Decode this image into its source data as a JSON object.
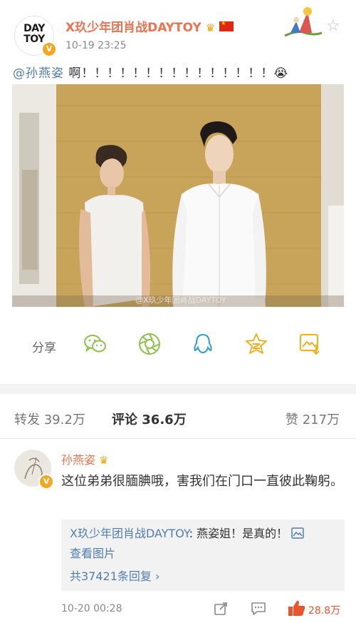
{
  "header": {
    "username": "X玖少年团肖战DAYTOY",
    "avatar_logo_line1": "DAY",
    "avatar_logo_line2": "TOY",
    "timestamp": "10-19 23:25"
  },
  "post": {
    "mention": "@孙燕姿",
    "text": " 啊！！！！！！！！！！！！！！！",
    "emoji": "😭",
    "watermark": "@X玖少年团肖战DAYTOY"
  },
  "share": {
    "label": "分享",
    "icons": [
      "wechat-icon",
      "moments-icon",
      "qq-icon",
      "qzone-icon",
      "save-image-icon"
    ]
  },
  "tabs": [
    {
      "label": "转发",
      "count": "39.2万",
      "active": false
    },
    {
      "label": "评论",
      "count": "36.6万",
      "active": true
    },
    {
      "label": "赞",
      "count": "217万",
      "active": false
    }
  ],
  "comment": {
    "author": "孙燕姿",
    "text": "这位弟弟很腼腆哦，害我们在门口一直彼此鞠躬。",
    "reply": {
      "author": "X玖少年团肖战DAYTOY",
      "text": ": 燕姿姐！是真的！",
      "view_image": "查看图片",
      "more_replies": "共37421条回复 ›"
    },
    "timestamp": "10-20 00:28",
    "likes": "28.8万"
  },
  "colors": {
    "accent_orange": "#eb7350",
    "link_blue": "#507daf",
    "like_red": "#e8552e",
    "icon_green": "#8bc34a"
  }
}
